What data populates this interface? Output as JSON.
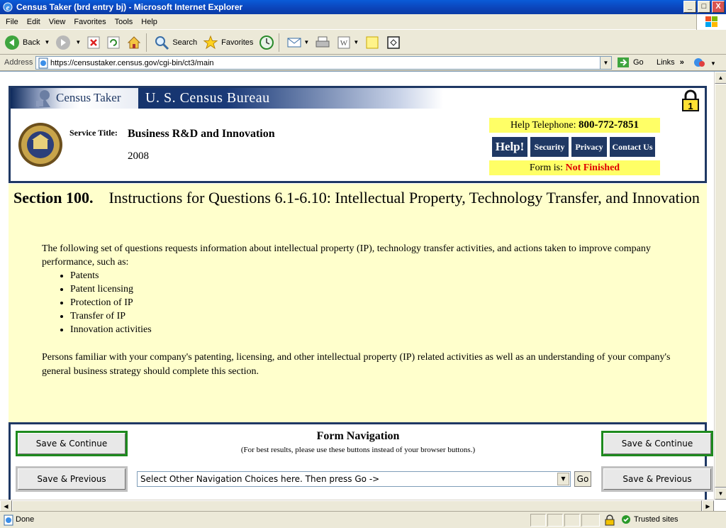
{
  "window": {
    "title": "Census Taker (brd entry bj) - Microsoft Internet Explorer",
    "minimize": "_",
    "maximize": "□",
    "close": "X"
  },
  "menu": [
    "File",
    "Edit",
    "View",
    "Favorites",
    "Tools",
    "Help"
  ],
  "toolbar": {
    "back": "Back",
    "search": "Search",
    "favorites": "Favorites"
  },
  "address": {
    "label": "Address",
    "url": "https://censustaker.census.gov/cgi-bin/ct3/main",
    "go": "Go",
    "links": "Links"
  },
  "header": {
    "app_name": "Census Taker",
    "agency": "U. S. Census Bureau",
    "service_label": "Service Title:",
    "service_title": "Business R&D and Innovation",
    "year": "2008",
    "help_phone_label": "Help Telephone:",
    "help_phone": "800-772-7851",
    "help_button": "Help!",
    "security": "Security",
    "privacy": "Privacy",
    "contact": "Contact Us",
    "form_status_label": "Form is:",
    "form_status": "Not Finished"
  },
  "section": {
    "number": "Section 100.",
    "title": "Instructions for Questions 6.1-6.10: Intellectual Property, Technology Transfer, and Innovation",
    "intro": "The following set of questions requests information about intellectual property (IP), technology transfer activities, and actions taken to improve company performance, such as:",
    "items": [
      "Patents",
      "Patent licensing",
      "Protection of IP",
      "Transfer of IP",
      "Innovation activities"
    ],
    "persons": "Persons familiar with your company's patenting, licensing, and other intellectual property (IP) related activities as well as an understanding of your company's general business strategy should complete this section."
  },
  "nav": {
    "title": "Form Navigation",
    "subtitle": "(For best results, please use these buttons instead of your browser buttons.)",
    "save_continue": "Save & Continue",
    "save_previous": "Save & Previous",
    "select_placeholder": "Select Other Navigation Choices here. Then press Go ->",
    "go": "Go"
  },
  "status": {
    "text": "Done",
    "zone": "Trusted sites"
  }
}
